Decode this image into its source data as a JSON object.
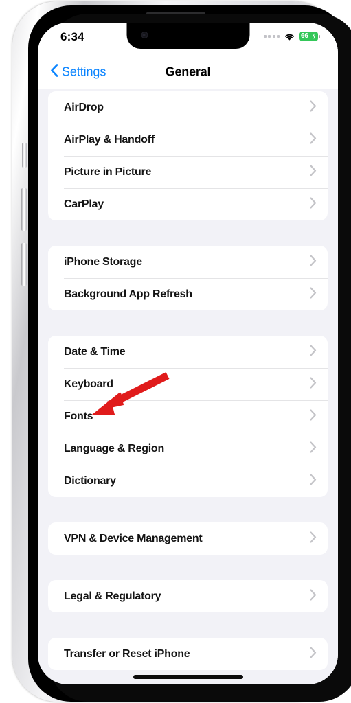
{
  "status_bar": {
    "time": "6:34",
    "signal_icon": "signal-dots-icon",
    "wifi_icon": "wifi-icon",
    "battery_percent": "66",
    "battery_charging_icon": "lightning-bolt-icon",
    "battery_color": "#34c759"
  },
  "nav": {
    "back_label": "Settings",
    "back_icon": "chevron-left-icon",
    "title": "General",
    "tint_color": "#0a84ff"
  },
  "groups": [
    {
      "rows": [
        {
          "label": "AirDrop",
          "accessory": "chevron-right-icon"
        },
        {
          "label": "AirPlay & Handoff",
          "accessory": "chevron-right-icon"
        },
        {
          "label": "Picture in Picture",
          "accessory": "chevron-right-icon"
        },
        {
          "label": "CarPlay",
          "accessory": "chevron-right-icon"
        }
      ]
    },
    {
      "rows": [
        {
          "label": "iPhone Storage",
          "accessory": "chevron-right-icon"
        },
        {
          "label": "Background App Refresh",
          "accessory": "chevron-right-icon"
        }
      ]
    },
    {
      "rows": [
        {
          "label": "Date & Time",
          "accessory": "chevron-right-icon"
        },
        {
          "label": "Keyboard",
          "accessory": "chevron-right-icon"
        },
        {
          "label": "Fonts",
          "accessory": "chevron-right-icon"
        },
        {
          "label": "Language & Region",
          "accessory": "chevron-right-icon"
        },
        {
          "label": "Dictionary",
          "accessory": "chevron-right-icon"
        }
      ]
    },
    {
      "rows": [
        {
          "label": "VPN & Device Management",
          "accessory": "chevron-right-icon"
        }
      ]
    },
    {
      "rows": [
        {
          "label": "Legal & Regulatory",
          "accessory": "chevron-right-icon"
        }
      ]
    },
    {
      "rows": [
        {
          "label": "Transfer or Reset iPhone",
          "accessory": "chevron-right-icon"
        }
      ]
    }
  ],
  "annotation": {
    "type": "arrow",
    "color": "#e01b1b",
    "points_to": "Fonts"
  },
  "device": {
    "home_indicator": "home-indicator",
    "buttons": [
      "silent-switch",
      "volume-up-button",
      "volume-down-button",
      "power-button"
    ]
  }
}
